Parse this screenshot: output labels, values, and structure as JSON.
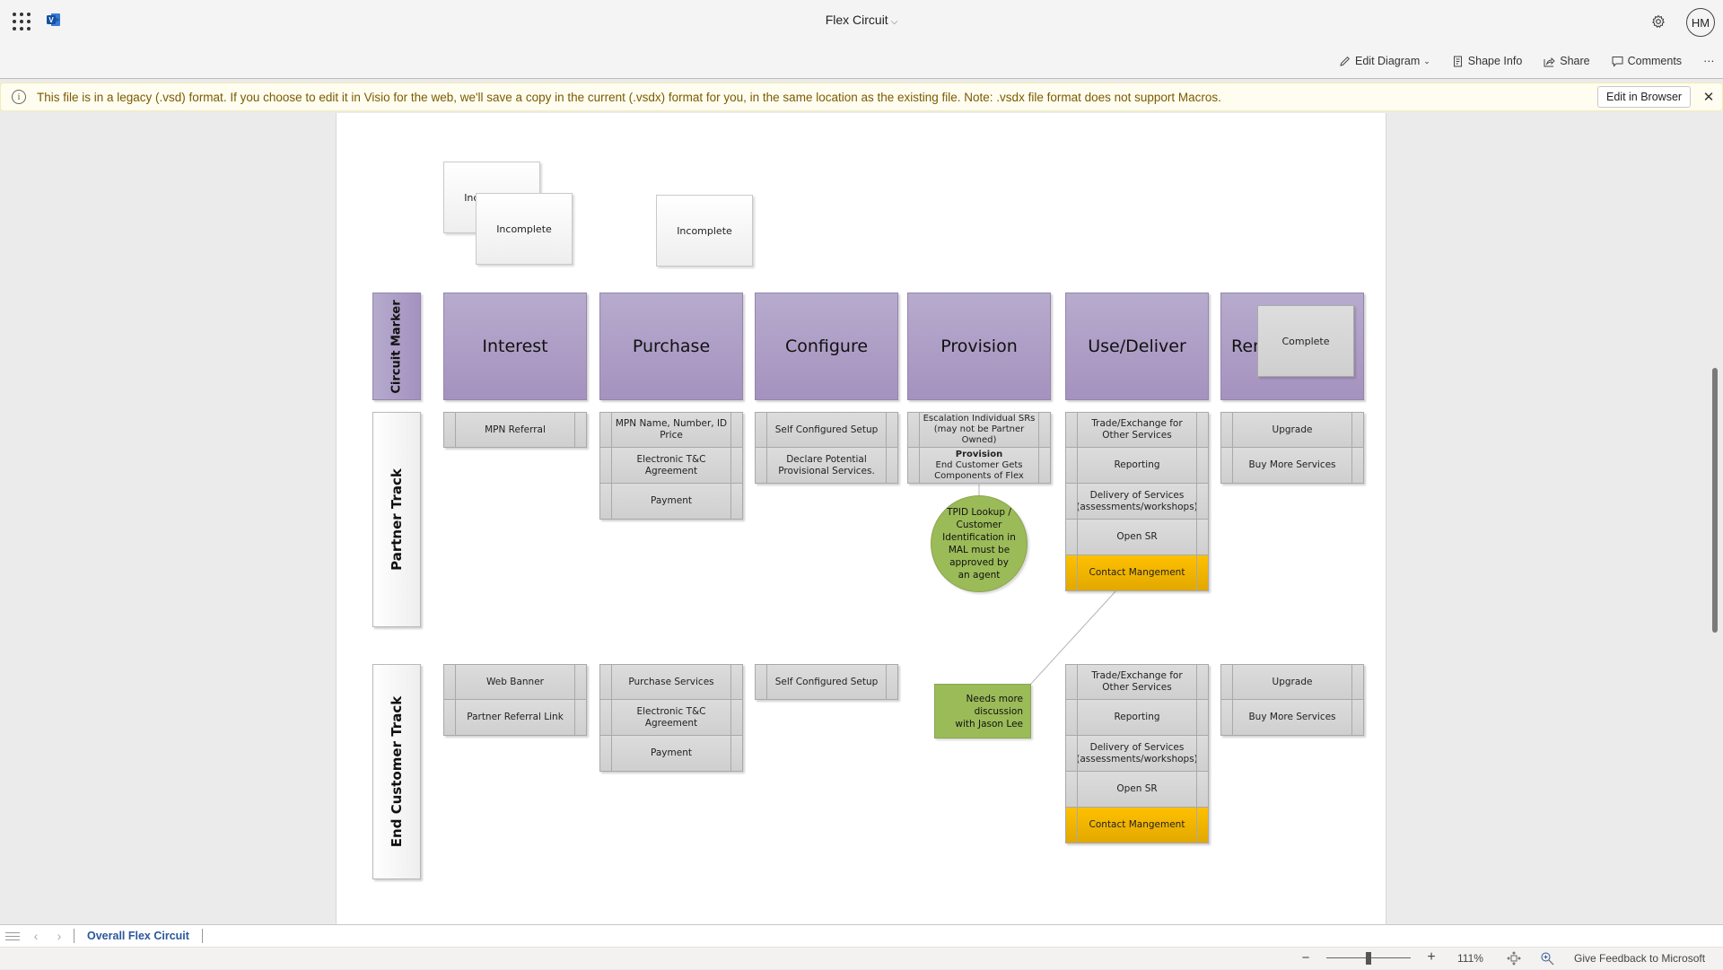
{
  "header": {
    "app_launcher_icon": "waffle-grid-icon",
    "app_logo_icon": "visio-logo-icon",
    "title": "Flex Circuit",
    "title_chevron": "⌵",
    "settings_icon": "gear-icon",
    "user_initials": "HM"
  },
  "command_bar": {
    "edit_diagram": "Edit Diagram",
    "shape_info": "Shape Info",
    "share": "Share",
    "comments": "Comments",
    "more": "···"
  },
  "banner": {
    "icon": "info-icon",
    "message": "This file is in a legacy (.vsd) format. If you choose to edit it in Visio for the web, we'll save a copy in the current (.vsdx) format for you, in the same location as the existing file. Note: .vsdx file format does not support Macros.",
    "edit_in_browser": "Edit in Browser",
    "close": "✕"
  },
  "diagram": {
    "status_cards": [
      {
        "label": "Incomplete"
      },
      {
        "label": "Incomplete"
      },
      {
        "label": "Incomplete"
      },
      {
        "label": "Complete"
      }
    ],
    "circuit_marker": "Circuit Marker",
    "phases": [
      {
        "label": "Interest"
      },
      {
        "label": "Purchase"
      },
      {
        "label": "Configure"
      },
      {
        "label": "Provision"
      },
      {
        "label": "Use/Deliver"
      },
      {
        "label": "Renew"
      }
    ],
    "partner_track": {
      "label": "Partner Track",
      "columns": [
        [
          "MPN Referral"
        ],
        [
          "MPN Name, Number, ID Price",
          "Electronic T&C Agreement",
          "Payment"
        ],
        [
          "Self Configured Setup",
          "Declare Potential Provisional Services."
        ],
        [
          "Escalation Individual SRs (may not be Partner Owned)",
          "Provision|End Customer Gets Components of Flex"
        ],
        [
          "Trade/Exchange for Other Services",
          "Reporting",
          "Delivery of Services (assessments/workshops)",
          "Open SR",
          "Contact Mangement"
        ],
        [
          "Upgrade",
          "Buy More Services"
        ]
      ]
    },
    "end_customer_track": {
      "label": "End Customer Track",
      "columns": [
        [
          "Web Banner",
          "Partner Referral Link"
        ],
        [
          "Purchase Services",
          "Electronic T&C Agreement",
          "Payment"
        ],
        [
          "Self Configured Setup"
        ],
        [],
        [
          "Trade/Exchange for Other Services",
          "Reporting",
          "Delivery of Services (assessments/workshops)",
          "Open SR",
          "Contact Mangement"
        ],
        [
          "Upgrade",
          "Buy More Services"
        ]
      ]
    },
    "provision_bold": "Provision",
    "provision_rest": "End Customer Gets Components of Flex",
    "tpid_note": "TPID Lookup / Customer Identification in MAL must be approved by an agent",
    "discussion_note": "Needs more discussion with Jason Lee",
    "colors": {
      "phase_purple": "#a99ac4",
      "cell_gray": "#d6d6d6",
      "highlight_orange": "#ffc000",
      "note_green": "#9bbb59"
    }
  },
  "sheet_tabs": {
    "menu_icon": "hamburger-icon",
    "prev_icon": "chevron-left-icon",
    "next_icon": "chevron-right-icon",
    "active_tab": "Overall Flex Circuit"
  },
  "status_bar": {
    "zoom_out": "−",
    "zoom_in": "+",
    "zoom_level": "111%",
    "zoom_percent": 111,
    "fit_icon": "fit-to-page-icon",
    "zoom_search_icon": "zoom-magnifier-icon",
    "feedback": "Give Feedback to Microsoft"
  }
}
